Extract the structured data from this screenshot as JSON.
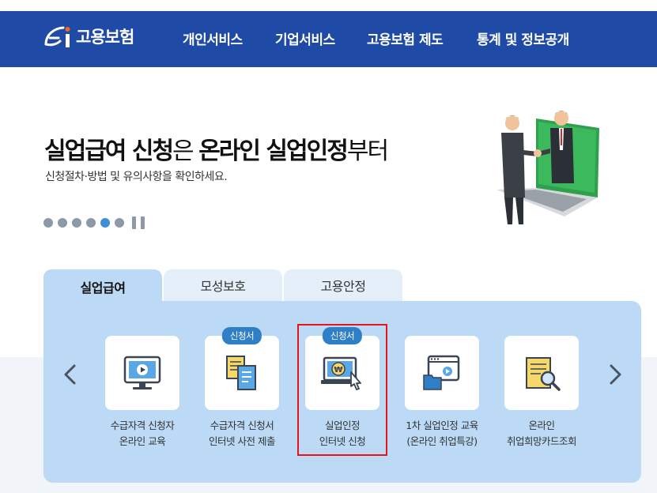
{
  "header": {
    "logo_text": "고용보험",
    "nav": [
      {
        "label": "개인서비스"
      },
      {
        "label": "기업서비스"
      },
      {
        "label": "고용보험 제도"
      },
      {
        "label": "통계 및 정보공개"
      }
    ]
  },
  "hero": {
    "title_part1": "실업급여 신청",
    "title_part2": "은 ",
    "title_part3": "온라인 실업인정",
    "title_part4": "부터",
    "subtitle": "신청절차·방법 및 유의사항을 확인하세요.",
    "active_dot": 5
  },
  "tabs": [
    {
      "label": "실업급여",
      "active": true
    },
    {
      "label": "모성보호",
      "active": false
    },
    {
      "label": "고용안정",
      "active": false
    }
  ],
  "services": [
    {
      "line1": "수급자격 신청자",
      "line2": "온라인 교육",
      "badge": "",
      "icon": "monitor-video-icon"
    },
    {
      "line1": "수급자격 신청서",
      "line2": "인터넷 사전 제출",
      "badge": "신청서",
      "icon": "documents-icon"
    },
    {
      "line1": "실업인정",
      "line2": "인터넷 신청",
      "badge": "신청서",
      "icon": "laptop-won-click-icon"
    },
    {
      "line1": "1차 실업인정 교육",
      "line2": "(온라인 취업특강)",
      "badge": "",
      "icon": "video-folder-icon"
    },
    {
      "line1": "온라인",
      "line2": "취업희망카드조회",
      "badge": "",
      "icon": "card-search-icon"
    }
  ],
  "colors": {
    "header_bg": "#1f4aa6",
    "panel_bg": "#bcdaf5",
    "badge_bg": "#2f7fc8",
    "highlight": "#e8141a",
    "dot_active": "#3e8fd6"
  }
}
